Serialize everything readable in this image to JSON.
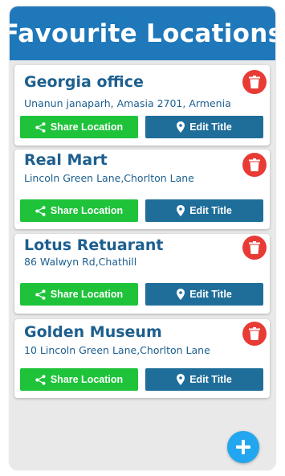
{
  "header": {
    "title": "Favourite Locations"
  },
  "colors": {
    "header_bg": "#1f78ba",
    "title_text": "#1d5f8f",
    "share_button": "#1ec33a",
    "edit_button": "#1f6e9a",
    "delete_button": "#e83b36",
    "fab": "#22a6ef"
  },
  "locations": [
    {
      "title": "Georgia office",
      "address": "Unanun janaparh, Amasia 2701, Armenia",
      "share_label": "Share Location",
      "edit_label": "Edit Title"
    },
    {
      "title": "Real Mart",
      "address": "Lincoln Green Lane,Chorlton Lane",
      "share_label": "Share Location",
      "edit_label": "Edit Title"
    },
    {
      "title": "Lotus Retuarant",
      "address": "86 Walwyn Rd,Chathill",
      "share_label": "Share Location",
      "edit_label": "Edit Title"
    },
    {
      "title": "Golden Museum",
      "address": "10 Lincoln Green Lane,Chorlton Lane",
      "share_label": "Share Location",
      "edit_label": "Edit Title"
    }
  ],
  "icons": {
    "delete": "trash-icon",
    "share": "share-icon",
    "edit": "location-pin-icon",
    "fab": "plus-icon"
  }
}
